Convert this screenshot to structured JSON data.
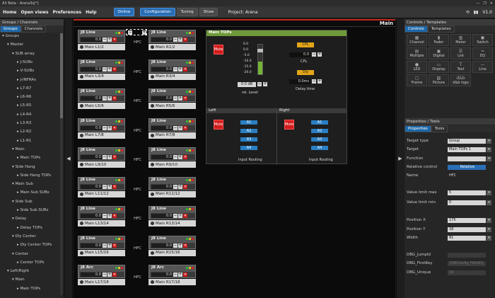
{
  "titlebar": {
    "title": "A3 Beta - Arena3s[*]",
    "controls": [
      "—",
      "❐",
      "✕"
    ]
  },
  "menubar": {
    "home": "Home",
    "open_views": "Open views",
    "preferences": "Preferences",
    "help": "Help",
    "online": "Online",
    "configuration": "Configuration",
    "tuning": "Tuning",
    "show": "Show",
    "project": "Project: Arena",
    "right_icons": [
      "⟲",
      "▮▮",
      "V1.0"
    ]
  },
  "groups": {
    "header": "Groups / Channels",
    "tabs": [
      "Groups",
      "Channels"
    ],
    "tree": [
      "Groups",
      "Master",
      "SUB array",
      "J-SUBs",
      "V-SUBs",
      "J-INFRAs",
      "L7-R7",
      "L6-R6",
      "L5-R5",
      "L4-R4",
      "L3-R3",
      "L2-R2",
      "L1-R1",
      "Main",
      "Main TOPs",
      "Side Hang",
      "Side Hang TOPs",
      "Main Sub",
      "Main Sub SUBs",
      "Side Sub",
      "Side Sub SUBs",
      "Delay",
      "Delay TOPs",
      "Dly Center",
      "Dly Center TOPs",
      "Center",
      "Center TOPs",
      "Left/Right",
      "Main",
      "Main TOPs"
    ]
  },
  "canvas": {
    "title": "Main",
    "value": "0.0",
    "hfc": "HFC",
    "left_modules": [
      {
        "type": "J8 Line",
        "label": "Main L1/2"
      },
      {
        "type": "J8 Line",
        "label": "Main L3/4"
      },
      {
        "type": "J8 Line",
        "label": "Main L5/6"
      },
      {
        "type": "J8 Line",
        "label": "Main L7/8"
      },
      {
        "type": "J8 Line",
        "label": "Main L9/10"
      },
      {
        "type": "J8 Line",
        "label": "Main L11/12"
      },
      {
        "type": "J8 Line",
        "label": "Main L13/14"
      },
      {
        "type": "J8 Line",
        "label": "Main L15/16"
      },
      {
        "type": "J8 Arc",
        "label": "Main L17/18"
      }
    ],
    "right_modules": [
      {
        "type": "J8 Line",
        "label": "Main R1/2"
      },
      {
        "type": "J8 Line",
        "label": "Main R3/4"
      },
      {
        "type": "J8 Line",
        "label": "Main R5/6"
      },
      {
        "type": "J8 Line",
        "label": "Main R7/8"
      },
      {
        "type": "J8 Line",
        "label": "Main R9/10"
      },
      {
        "type": "J8 Line",
        "label": "Main R11/12"
      },
      {
        "type": "J8 Line",
        "label": "Main R13/14"
      },
      {
        "type": "J8 Line",
        "label": "Main R15/16"
      },
      {
        "type": "J8 Arc",
        "label": "Main R17/18"
      }
    ],
    "maintops": {
      "title": "Main TOPs",
      "mute": "Mute",
      "scale": [
        "6.0",
        "0.0",
        "-5.0",
        "-10.0",
        "-15.0",
        "-20.0"
      ],
      "level": "0.0 dB",
      "level_label": "rel. Level",
      "cpl_btn": "CPL",
      "cpl_val": "0.0",
      "cpl_label": "CPL",
      "dly_btn": "Dly",
      "dly_val": "0.0ms",
      "dly_label": "Delay time",
      "left": {
        "title": "Left",
        "mute": "Mute",
        "inputs": [
          "A1",
          "A2",
          "A3",
          "A4"
        ],
        "routing": "Input Routing"
      },
      "right": {
        "title": "Right",
        "mute": "Mute",
        "inputs": [
          "A1",
          "A2",
          "A3",
          "A4"
        ],
        "routing": "Input Routing"
      }
    }
  },
  "controls": {
    "header": "Controls / Templates",
    "tabs": [
      "Controls",
      "Templates"
    ],
    "items": [
      {
        "label": "Channel",
        "icon": "▦"
      },
      {
        "label": "Fader",
        "icon": "▮"
      },
      {
        "label": "Meter",
        "icon": "▥"
      },
      {
        "label": "Switch",
        "icon": "◼"
      },
      {
        "label": "Multiple",
        "icon": "▤"
      },
      {
        "label": "Digital",
        "icon": "▣"
      },
      {
        "label": "List",
        "icon": "☰"
      },
      {
        "label": "EQ",
        "icon": "≈"
      },
      {
        "label": "LED",
        "icon": "●"
      },
      {
        "label": "Display",
        "icon": "▭"
      },
      {
        "label": "Text",
        "icon": "T"
      },
      {
        "label": "Line",
        "icon": "—"
      },
      {
        "label": "Frame",
        "icon": "▢"
      },
      {
        "label": "Picture",
        "icon": "▨"
      },
      {
        "label": "d&b logo",
        "icon": "d&b"
      }
    ]
  },
  "properties": {
    "header": "Properties / Tools",
    "tabs": [
      "Properties",
      "Tools"
    ],
    "rows": [
      {
        "k": "Target type",
        "v": "Group",
        "sel": true
      },
      {
        "k": "Target",
        "v": "Main TOPs 1",
        "sel": true
      },
      {
        "k": "Function",
        "v": "",
        "sel": true
      },
      {
        "k": "Relative control",
        "v": "Relative",
        "btn": true
      },
      {
        "k": "Name",
        "v": "HFC",
        "plain": true
      },
      {
        "k": "Value limit max",
        "v": "5",
        "sel": true
      },
      {
        "k": "Value limit min",
        "v": "0",
        "sel": true
      },
      {
        "k": "Position X",
        "v": "175",
        "sel": true
      },
      {
        "k": "Position Y",
        "v": "18",
        "sel": true
      },
      {
        "k": "Width",
        "v": "81",
        "sel": true
      },
      {
        "k": "DBG_JumpId",
        "v": "",
        "dis": true
      },
      {
        "k": "DBG_FirstKey",
        "v": "{5B/Config_Fillin0l}",
        "dis": true
      },
      {
        "k": "DBG_Unique",
        "v": "19",
        "dis": true
      }
    ]
  }
}
